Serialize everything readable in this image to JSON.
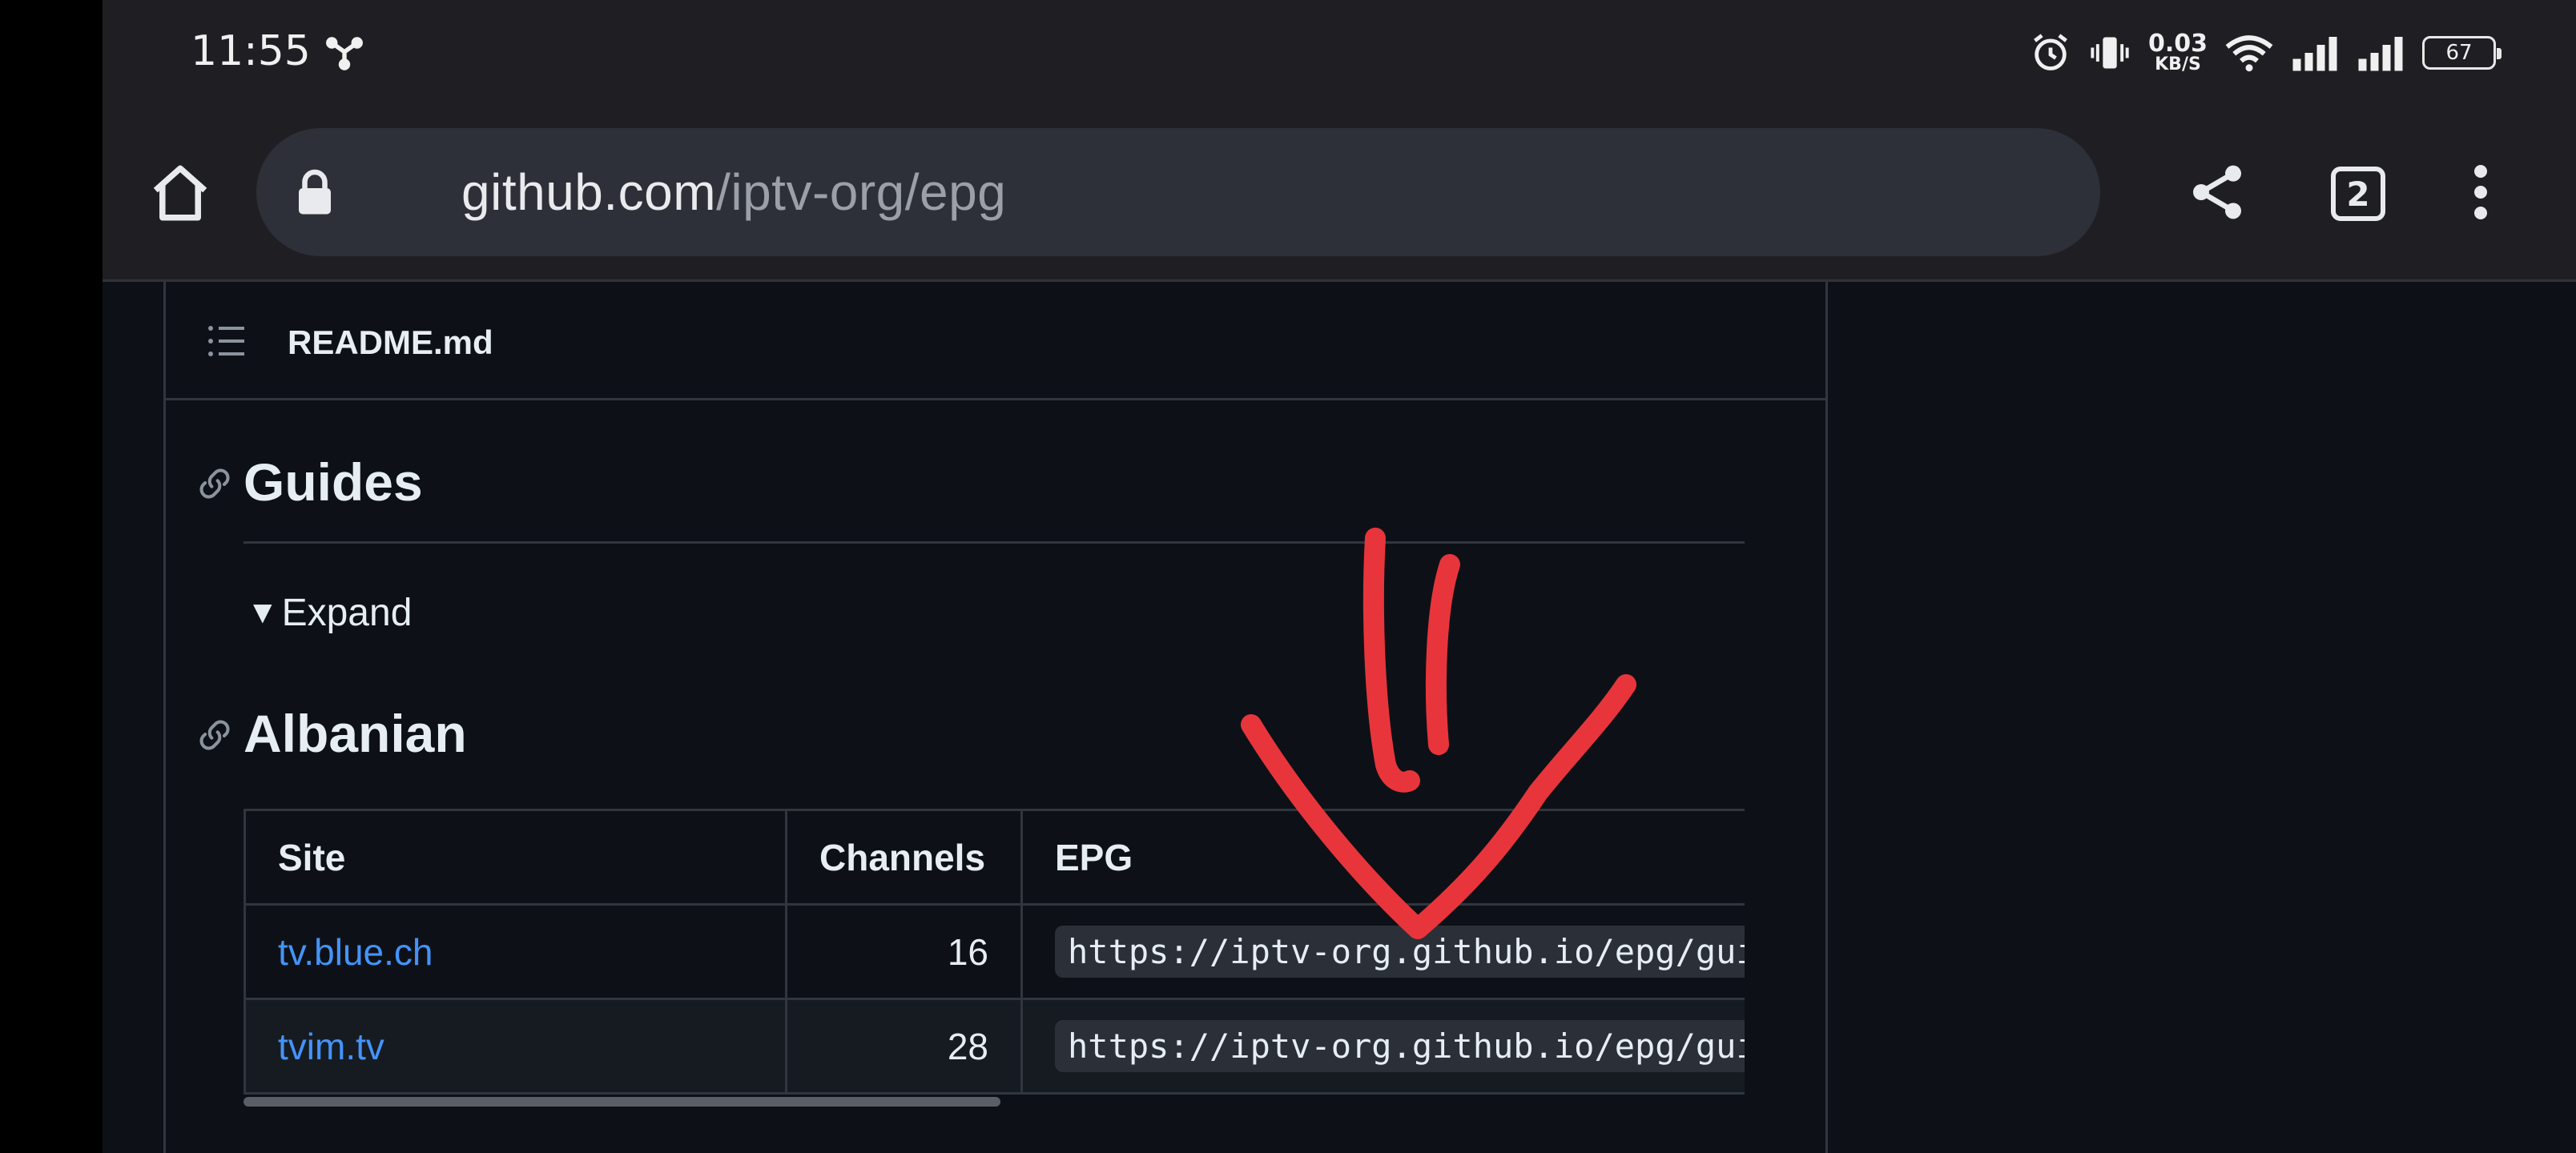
{
  "status_bar": {
    "time": "11:55",
    "net_speed_value": "0.03",
    "net_speed_unit": "KB/S",
    "battery": "67",
    "icons": [
      "share-nodes-icon",
      "alarm-icon",
      "vibrate-icon",
      "wifi-icon",
      "signal-icon",
      "signal-icon",
      "battery-icon"
    ]
  },
  "browser": {
    "url_domain": "github.com",
    "url_path": "/iptv-org/epg",
    "tab_count": "2",
    "icons": [
      "home-icon",
      "lock-icon",
      "share-icon",
      "tabs-icon",
      "more-vert-icon"
    ]
  },
  "readme": {
    "file_name": "README.md",
    "toc_icon": "list-icon",
    "sections": [
      {
        "title": "Guides",
        "anchor_icon": "link-icon"
      },
      {
        "title": "Albanian",
        "anchor_icon": "link-icon"
      }
    ],
    "details_summary": "Expand",
    "details_marker": "▼"
  },
  "table": {
    "headers": [
      "Site",
      "Channels",
      "EPG"
    ],
    "rows": [
      {
        "site": "tv.blue.ch",
        "channels": "16",
        "epg": "https://iptv-org.github.io/epg/guides/al/tv.blue.ch.epg.xml"
      },
      {
        "site": "tvim.tv",
        "channels": "28",
        "epg": "https://iptv-org.github.io/epg/guides/al/tvim.tv.epg.xml"
      }
    ]
  },
  "colors": {
    "page_bg": "#0d1117",
    "border": "#30363d",
    "link": "#4493f8",
    "annotation": "#e8353b"
  }
}
